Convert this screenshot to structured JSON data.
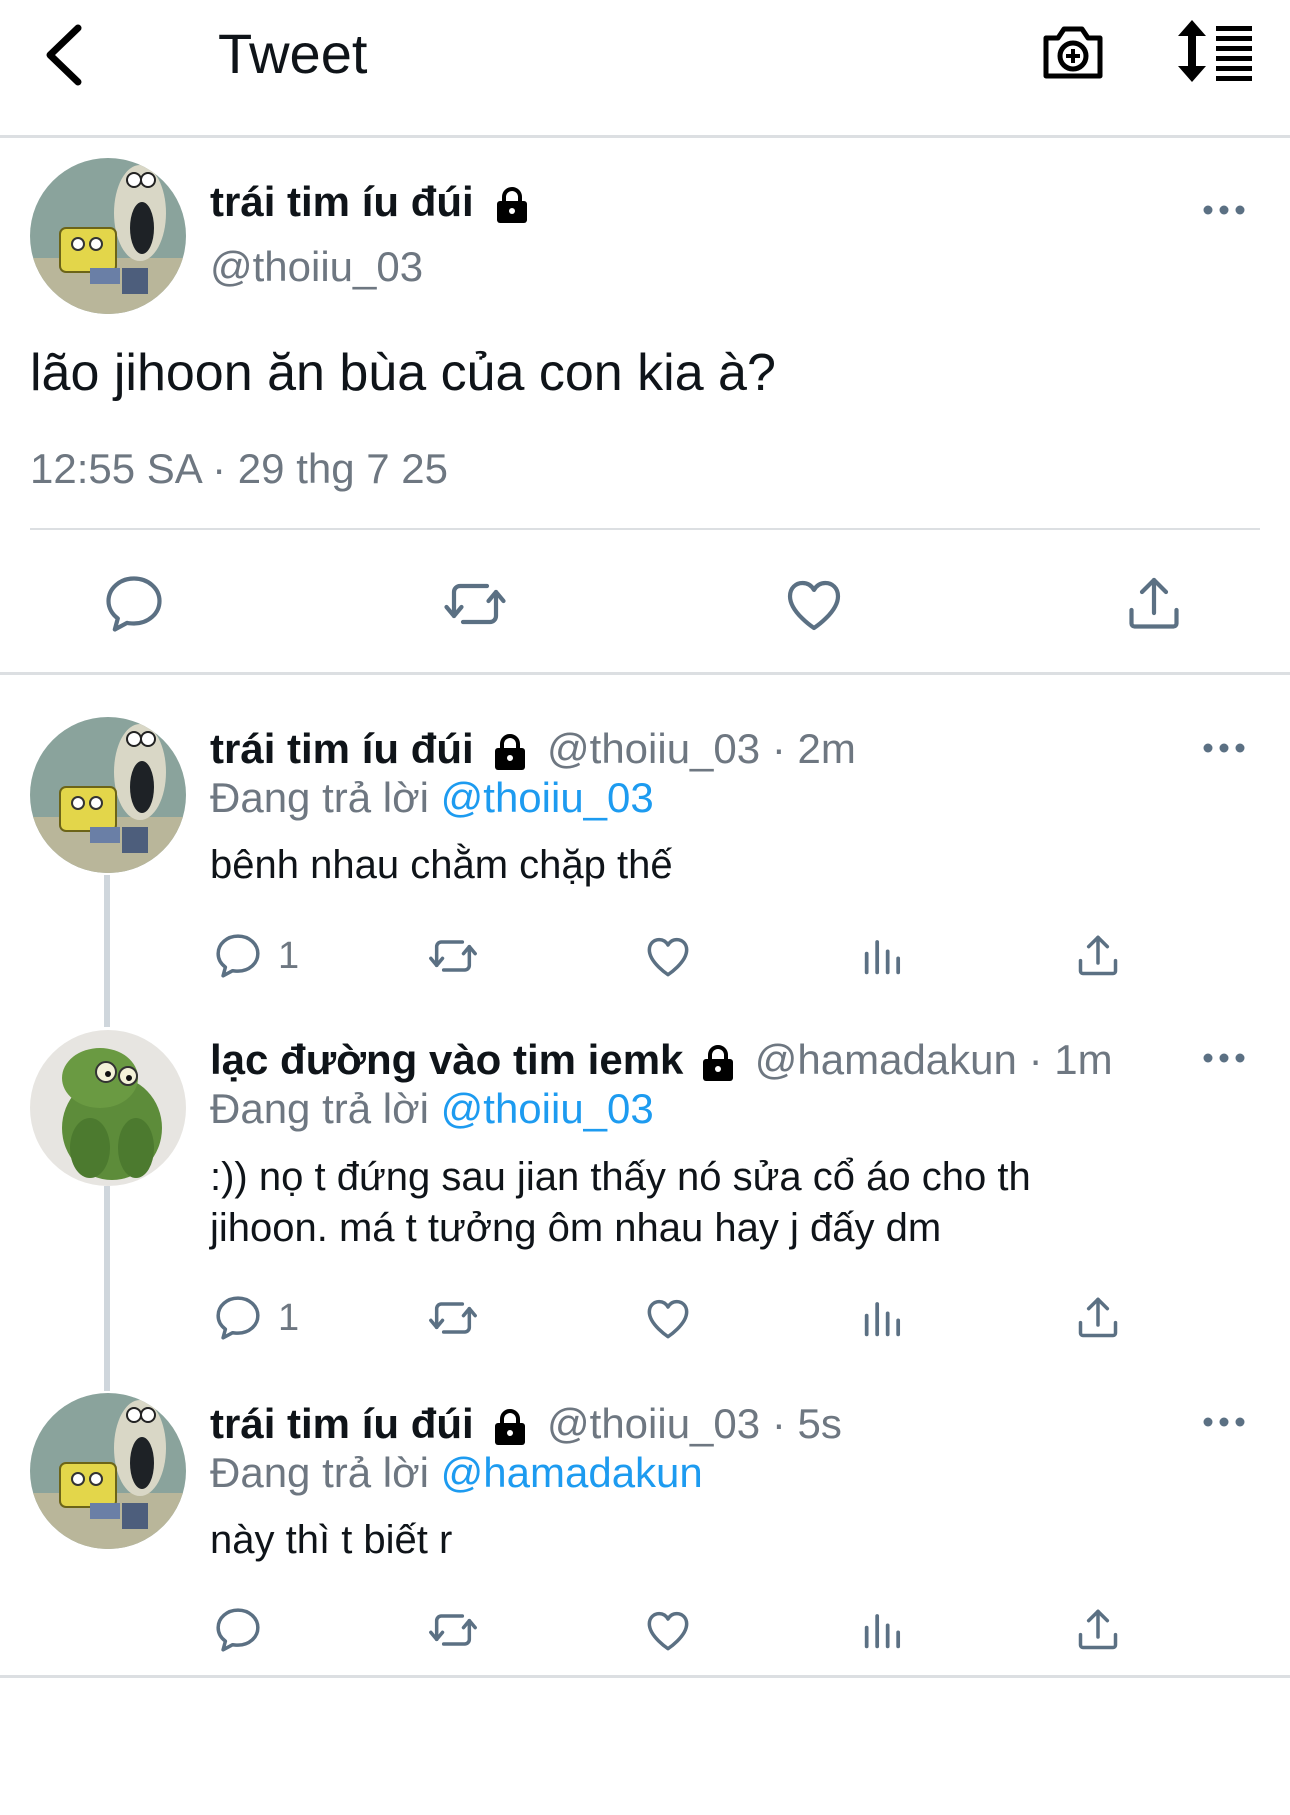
{
  "header": {
    "title": "Tweet",
    "back_icon": "chevron-left-icon",
    "camera_icon": "camera-plus-icon",
    "sort_icon": "sort-list-icon"
  },
  "main_tweet": {
    "author_name": "trái tim íu đúi",
    "handle": "@thoiiu_03",
    "text": "lão jihoon ăn bùa của con kia à?",
    "timestamp": "12:55 SA · 29 thg 7 25",
    "protected_icon": "lock-icon",
    "avatar_desc": "cartoon-sponge-avatar"
  },
  "replies": [
    {
      "author_name": "trái tim íu đúi",
      "handle": "@thoiiu_03",
      "dot": "·",
      "time": "2m",
      "replying_prefix": "Đang trả lời",
      "replying_to": "@thoiiu_03",
      "text": "bênh nhau chằm chặp thế",
      "reply_count": "1"
    },
    {
      "author_name": "lạc đường vào tim iemk",
      "handle": "@hamadakun",
      "dot": "·",
      "time": "1m",
      "replying_prefix": "Đang trả lời",
      "replying_to": "@thoiiu_03",
      "text": ":)) nọ t đứng sau jian thấy nó sửa cổ áo cho th\njihoon. má t tưởng ôm nhau hay j đấy dm",
      "reply_count": "1"
    },
    {
      "author_name": "trái tim íu đúi",
      "handle": "@thoiiu_03",
      "dot": "·",
      "time": "5s",
      "replying_prefix": "Đang trả lời",
      "replying_to": "@hamadakun",
      "text": "này thì t biết r",
      "reply_count": ""
    }
  ],
  "colors": {
    "accent": "#1d9bf0",
    "secondary_text": "#6e7781",
    "icon": "#5b7083",
    "divider": "#dcdfe2"
  }
}
